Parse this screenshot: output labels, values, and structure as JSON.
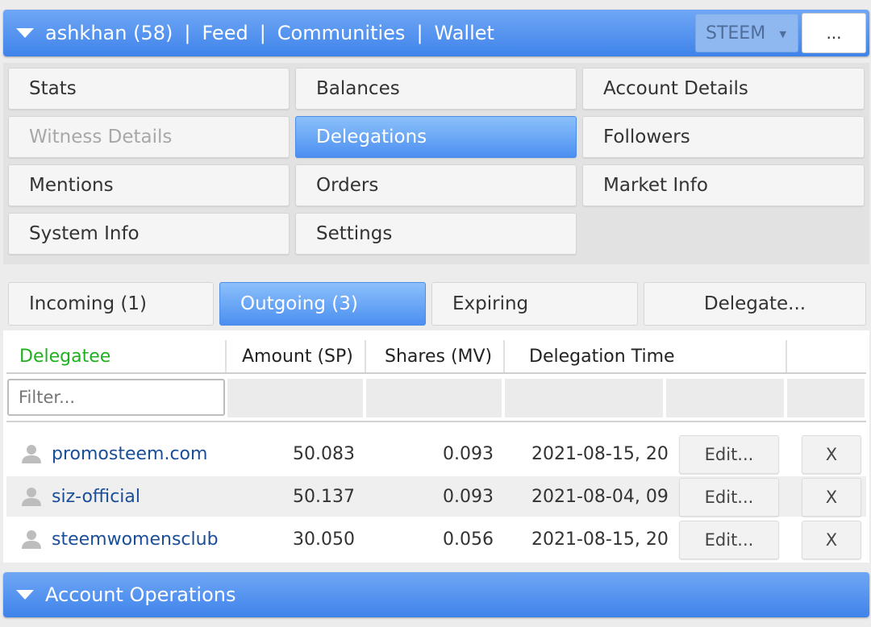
{
  "header": {
    "account": "ashkhan (58)",
    "separator": "|",
    "links": [
      "Feed",
      "Communities",
      "Wallet"
    ],
    "chain_select": "STEEM",
    "more_label": "..."
  },
  "sections": [
    {
      "label": "Stats",
      "state": "normal"
    },
    {
      "label": "Balances",
      "state": "normal"
    },
    {
      "label": "Account Details",
      "state": "normal"
    },
    {
      "label": "Witness Details",
      "state": "disabled"
    },
    {
      "label": "Delegations",
      "state": "active"
    },
    {
      "label": "Followers",
      "state": "normal"
    },
    {
      "label": "Mentions",
      "state": "normal"
    },
    {
      "label": "Orders",
      "state": "normal"
    },
    {
      "label": "Market Info",
      "state": "normal"
    },
    {
      "label": "System Info",
      "state": "normal"
    },
    {
      "label": "Settings",
      "state": "normal"
    }
  ],
  "tabs": [
    {
      "label": "Incoming (1)",
      "active": false
    },
    {
      "label": "Outgoing (3)",
      "active": true
    },
    {
      "label": "Expiring",
      "active": false
    },
    {
      "label": "Delegate...",
      "active": false
    }
  ],
  "table": {
    "columns": [
      "Delegatee",
      "Amount (SP)",
      "Shares (MV)",
      "Delegation Time"
    ],
    "filter_placeholder": "Filter...",
    "edit_label": "Edit...",
    "remove_label": "X",
    "rows": [
      {
        "delegatee": "promosteem.com",
        "amount": "50.083",
        "shares": "0.093",
        "time": "2021-08-15, 20:"
      },
      {
        "delegatee": "siz-official",
        "amount": "50.137",
        "shares": "0.093",
        "time": "2021-08-04, 09:"
      },
      {
        "delegatee": "steemwomensclub",
        "amount": "30.050",
        "shares": "0.056",
        "time": "2021-08-15, 20:"
      }
    ]
  },
  "footer": {
    "title": "Account Operations"
  },
  "colors": {
    "accent_blue": "#4b8ff0",
    "delegatee_header": "#20b020",
    "link": "#1a4e99"
  }
}
